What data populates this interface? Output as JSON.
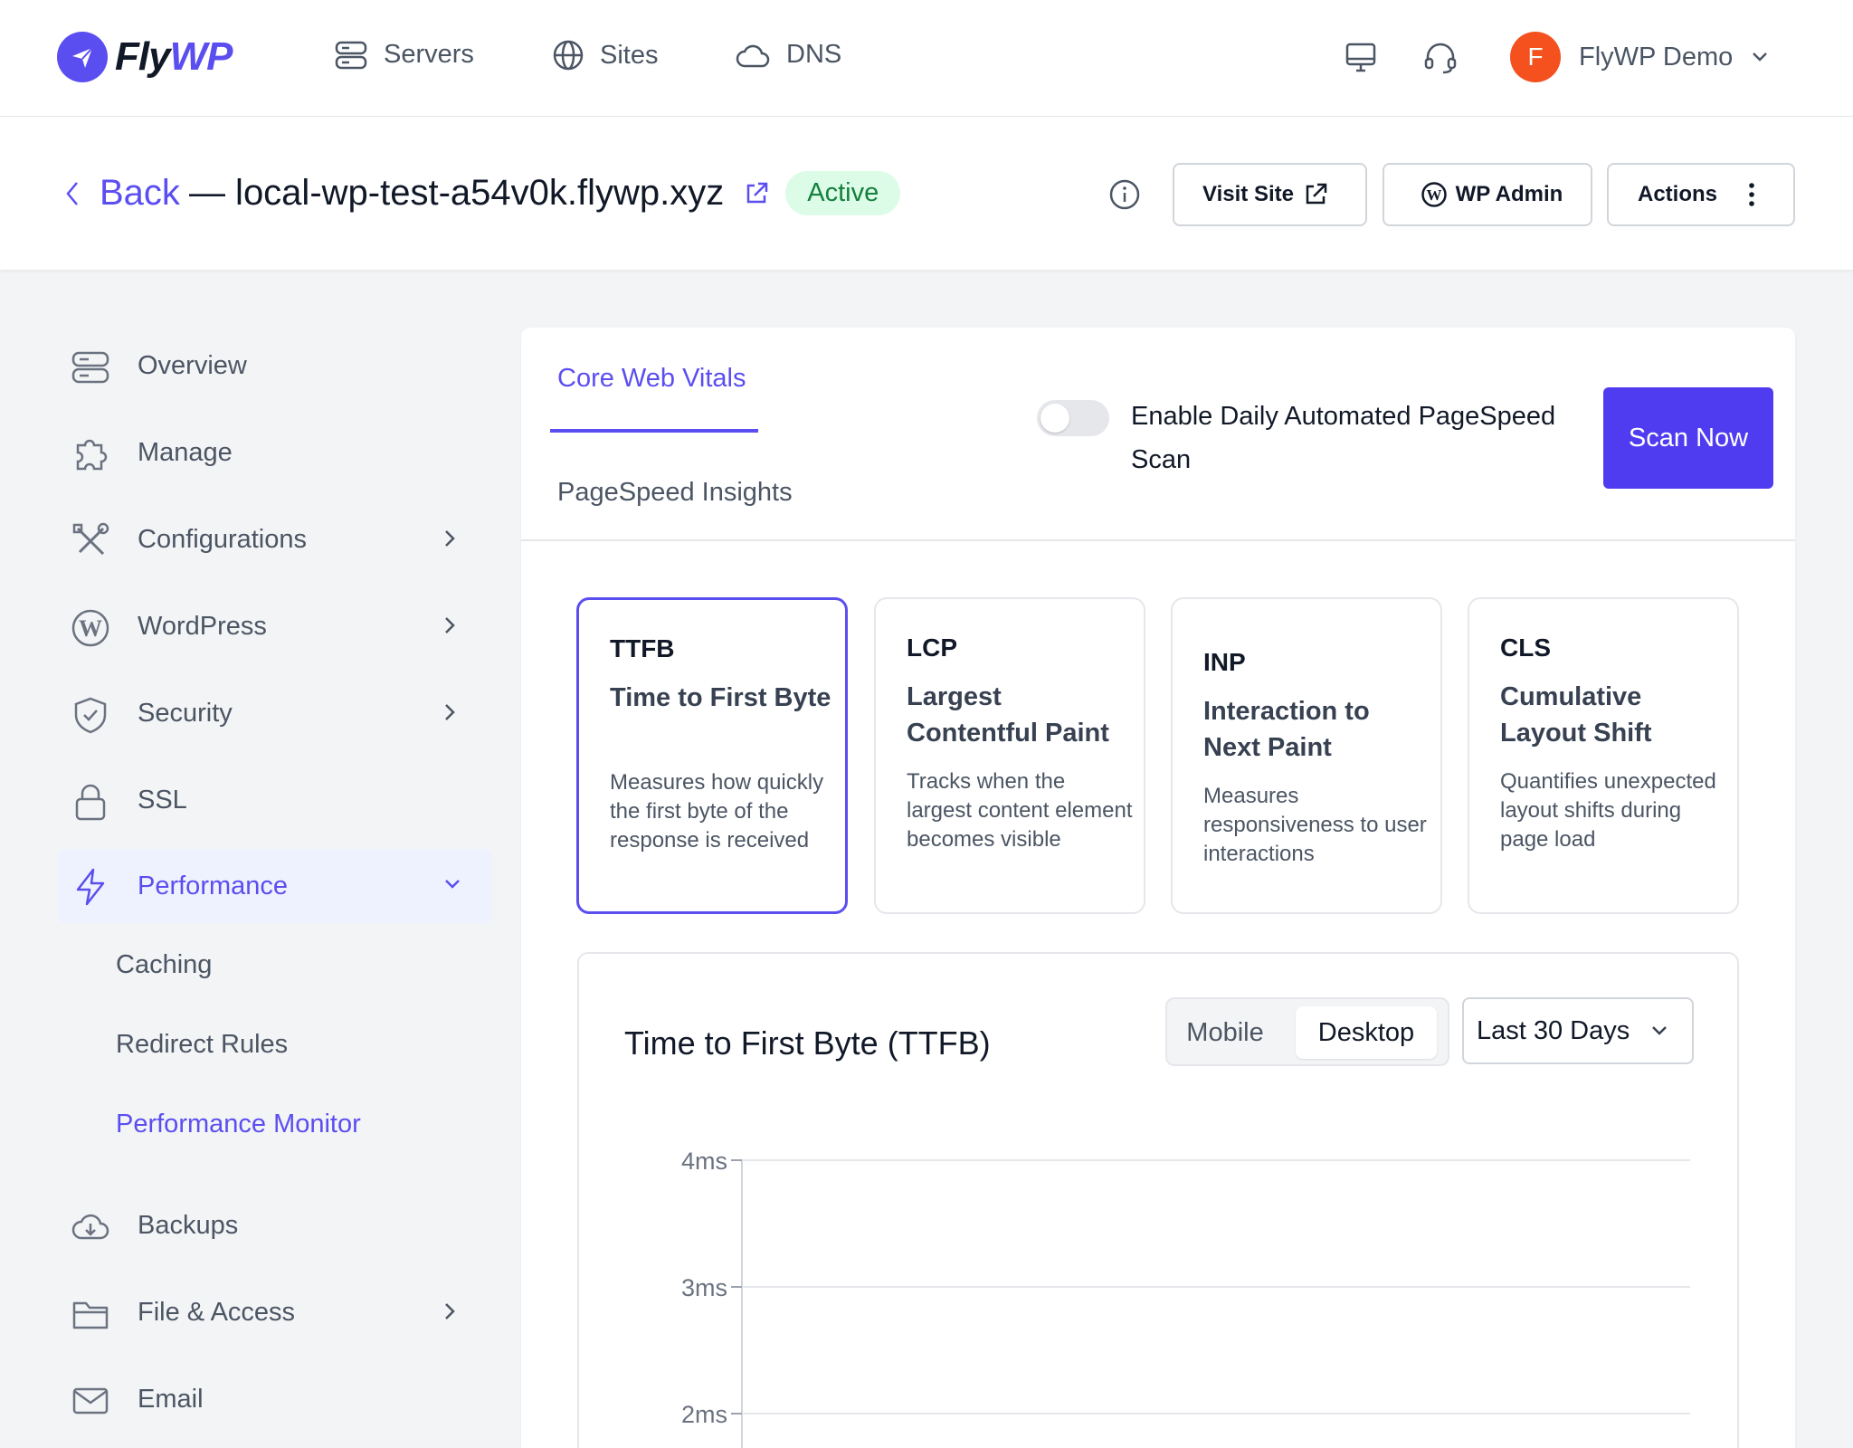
{
  "brand": {
    "fly": "Fly",
    "wp": "WP"
  },
  "nav": {
    "servers": "Servers",
    "sites": "Sites",
    "dns": "DNS"
  },
  "user": {
    "initial": "F",
    "name": "FlyWP Demo"
  },
  "header": {
    "back_label": "Back",
    "site_title": "— local-wp-test-a54v0k.flywp.xyz",
    "status": "Active",
    "visit_site": "Visit Site",
    "wp_admin": "WP Admin",
    "actions": "Actions"
  },
  "sidebar": {
    "items": [
      {
        "label": "Overview"
      },
      {
        "label": "Manage"
      },
      {
        "label": "Configurations"
      },
      {
        "label": "WordPress"
      },
      {
        "label": "Security"
      },
      {
        "label": "SSL"
      },
      {
        "label": "Performance"
      },
      {
        "label": "Backups"
      },
      {
        "label": "File & Access"
      },
      {
        "label": "Email"
      }
    ],
    "subitems": [
      {
        "label": "Caching"
      },
      {
        "label": "Redirect Rules"
      },
      {
        "label": "Performance Monitor"
      }
    ]
  },
  "main": {
    "tabs": [
      {
        "label": "Core Web Vitals"
      },
      {
        "label": "PageSpeed Insights"
      }
    ],
    "toggle_label": "Enable Daily Automated PageSpeed Scan",
    "toggle_on": false,
    "scan_button": "Scan Now",
    "metrics": [
      {
        "abbr": "TTFB",
        "name": "Time to First Byte",
        "desc": "Measures how quickly the first byte of the response is received"
      },
      {
        "abbr": "LCP",
        "name": "Largest Contentful Paint",
        "desc": "Tracks when the largest content element becomes visible"
      },
      {
        "abbr": "INP",
        "name": "Interaction to Next Paint",
        "desc": "Measures responsiveness to user interactions"
      },
      {
        "abbr": "CLS",
        "name": "Cumulative Layout Shift",
        "desc": "Quantifies unexpected layout shifts during page load"
      }
    ],
    "chart_title": "Time to First Byte (TTFB)",
    "device_options": [
      "Mobile",
      "Desktop"
    ],
    "selected_device": "Desktop",
    "range": "Last 30 Days"
  },
  "colors": {
    "accent": "#5b4ef0",
    "button": "#4f3cf0",
    "avatar": "#f4511e",
    "active_badge_bg": "#dcfce7",
    "active_badge_text": "#15803d"
  },
  "chart_data": {
    "type": "line",
    "title": "Time to First Byte (TTFB)",
    "xlabel": "",
    "ylabel": "",
    "yticks": [
      "4ms",
      "3ms",
      "2ms"
    ],
    "series": [],
    "grid": true
  }
}
